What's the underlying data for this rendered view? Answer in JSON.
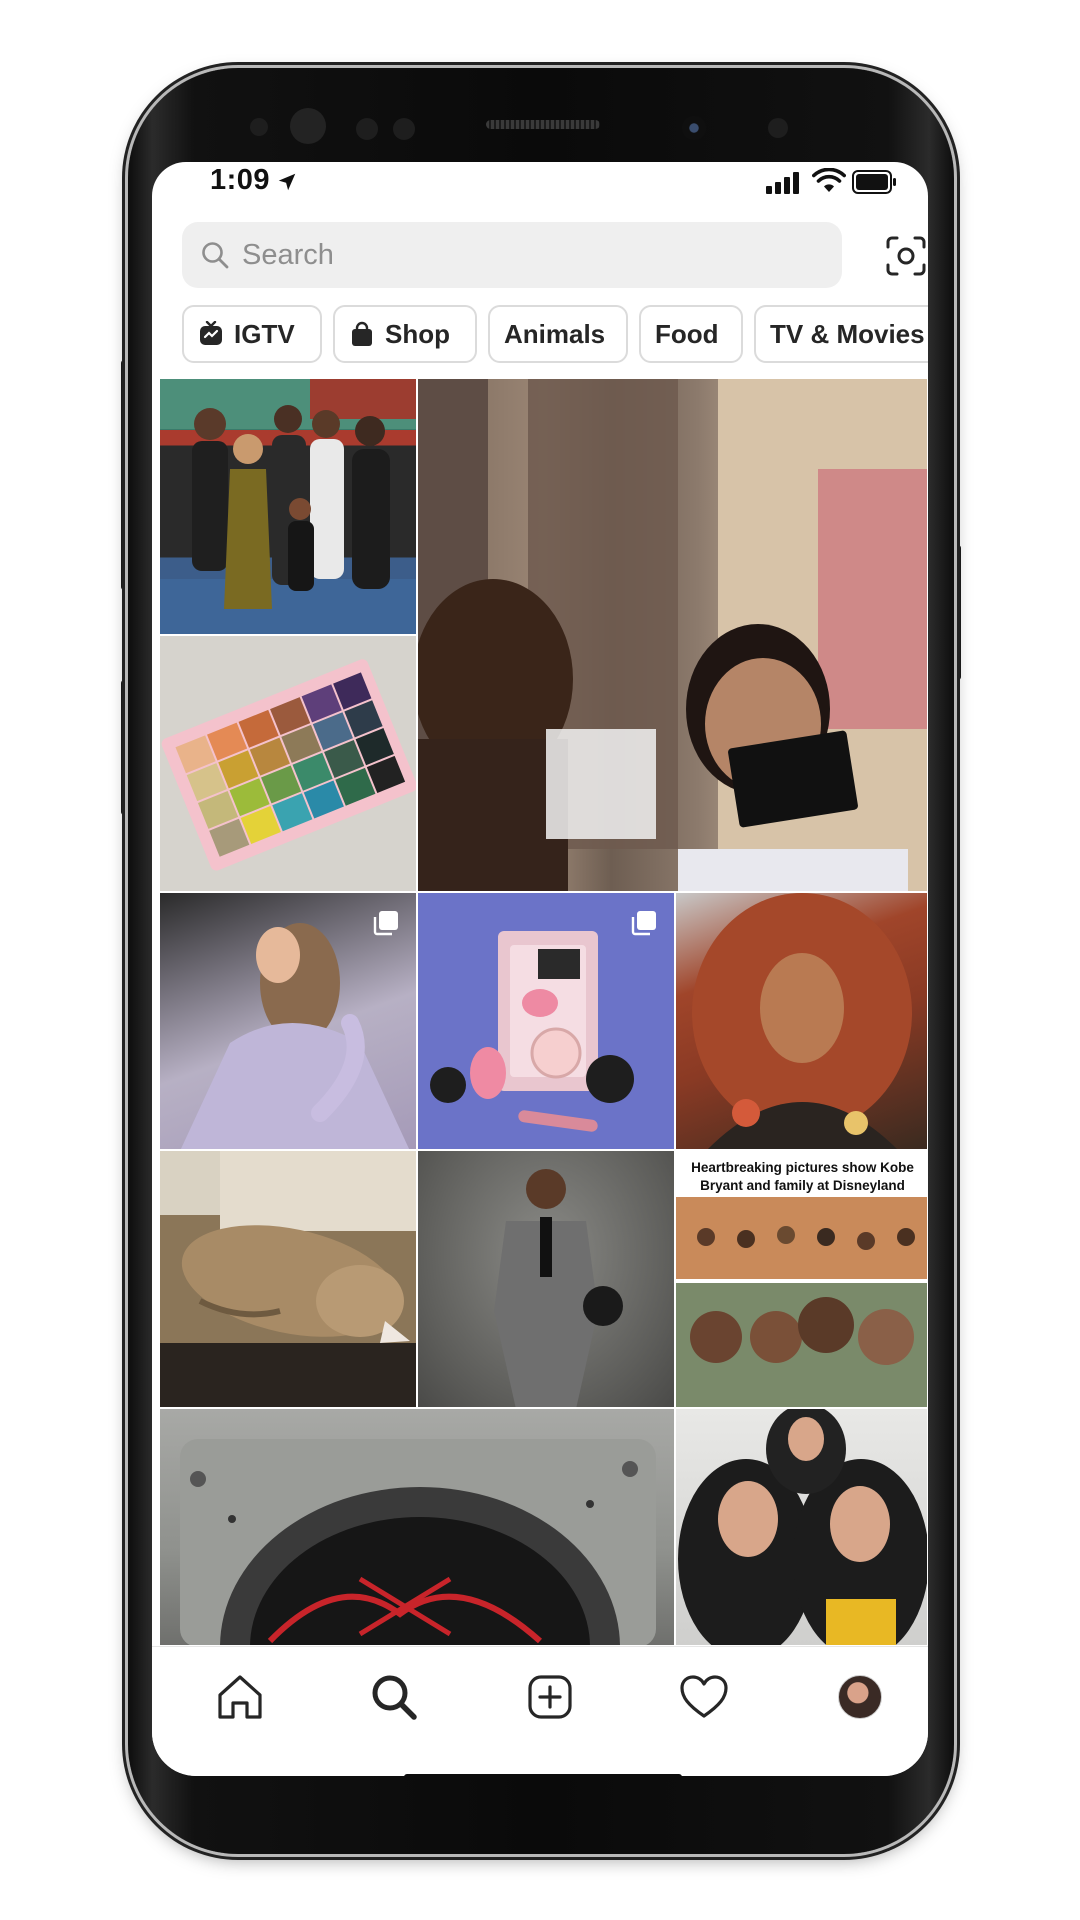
{
  "status_bar": {
    "time": "1:09"
  },
  "search": {
    "placeholder": "Search"
  },
  "chips": [
    {
      "label": "IGTV",
      "icon": "igtv-icon"
    },
    {
      "label": "Shop",
      "icon": "shopping-bag-icon"
    },
    {
      "label": "Animals"
    },
    {
      "label": "Food"
    },
    {
      "label": "TV & Movies"
    }
  ],
  "grid": {
    "tiles": [
      {
        "name": "photo-group-portrait"
      },
      {
        "name": "video-father-and-child"
      },
      {
        "name": "photo-eyeshadow-palette"
      },
      {
        "name": "photo-gown-portrait",
        "multi": true
      },
      {
        "name": "photo-elf-makeup-set",
        "multi": true
      },
      {
        "name": "photo-red-curly-hair-portrait"
      },
      {
        "name": "photo-sleeping-cat"
      },
      {
        "name": "photo-man-with-basketball"
      },
      {
        "name": "photo-news-headline"
      },
      {
        "name": "video-speaker-closeup"
      },
      {
        "name": "photo-curly-hair-twins"
      }
    ],
    "news_headline": "Heartbreaking pictures show Kobe Bryant and family at Disneyland"
  },
  "tab_bar": {
    "items": [
      "home-icon",
      "search-icon",
      "create-icon",
      "heart-icon",
      "profile-avatar"
    ]
  }
}
